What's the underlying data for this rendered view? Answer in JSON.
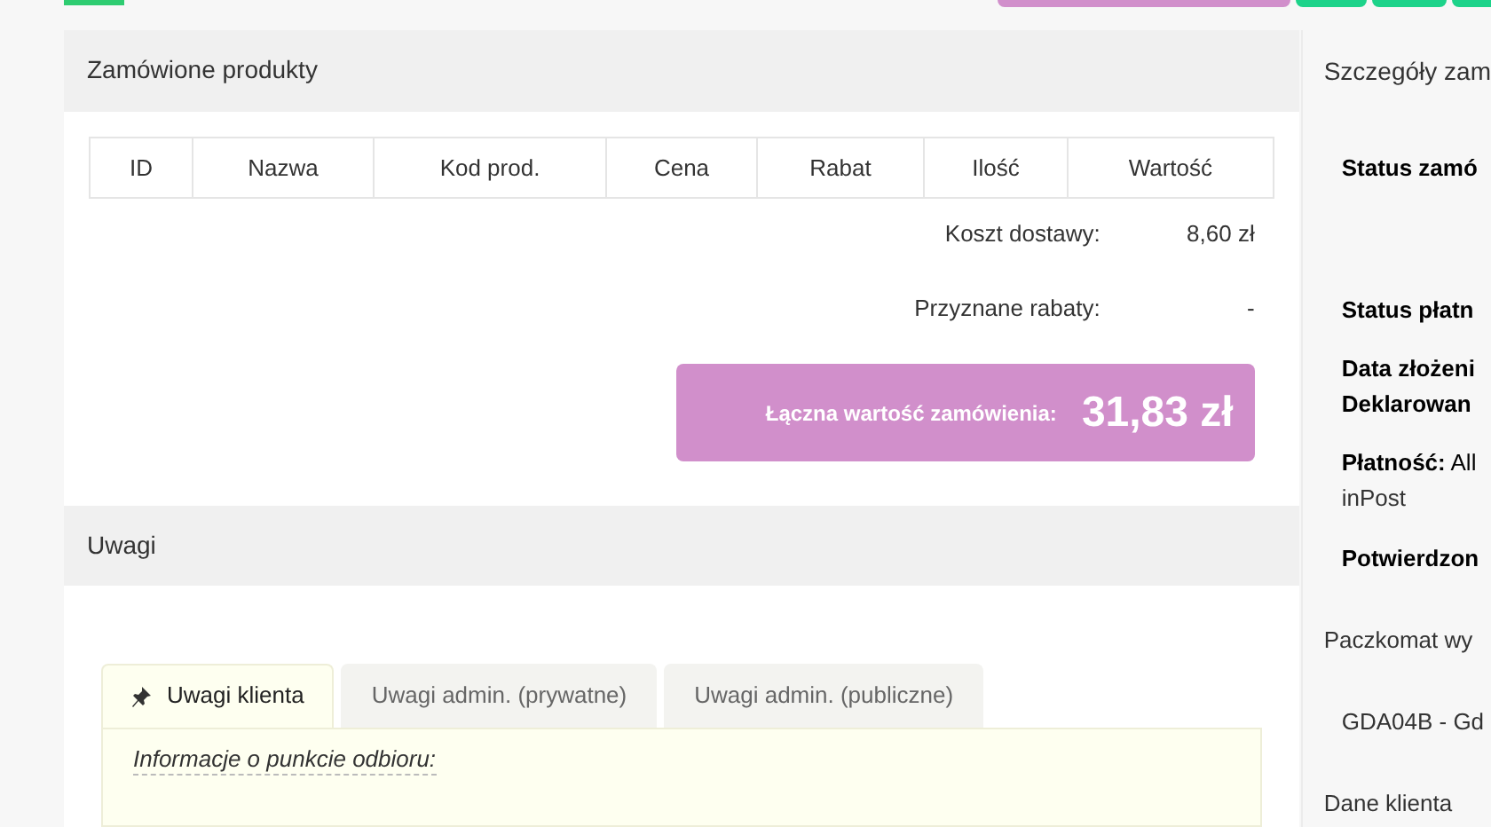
{
  "products": {
    "title": "Zamówione produkty",
    "columns": [
      "ID",
      "Nazwa",
      "Kod prod.",
      "Cena",
      "Rabat",
      "Ilość",
      "Wartość"
    ],
    "summary": [
      {
        "label": "Koszt dostawy:",
        "value": "8,60 zł"
      },
      {
        "label": "Przyznane rabaty:",
        "value": "-"
      }
    ],
    "total": {
      "label": "Łączna wartość zamówienia:",
      "value": "31,83 zł"
    }
  },
  "notes": {
    "title": "Uwagi",
    "tabs": [
      {
        "label": "Uwagi klienta",
        "selected": true
      },
      {
        "label": "Uwagi admin. (prywatne)",
        "selected": false
      },
      {
        "label": "Uwagi admin. (publiczne)",
        "selected": false
      }
    ],
    "content_heading": "Informacje o punkcie odbioru:"
  },
  "details": {
    "title": "Szczegóły zam",
    "lines": [
      {
        "kind": "bold",
        "text": "Status zamó"
      },
      {
        "kind": "bold",
        "text": "Status płatn"
      },
      {
        "kind": "bold",
        "text": "Data złożeni"
      },
      {
        "kind": "bold",
        "text": "Deklarowan"
      },
      {
        "kind": "labeled",
        "label": "Płatność:",
        "text": "All"
      },
      {
        "kind": "plain",
        "text": "inPost"
      },
      {
        "kind": "bold",
        "text": "Potwierdzon"
      },
      {
        "kind": "section",
        "text": "Paczkomat wy"
      },
      {
        "kind": "plain",
        "text": "GDA04B - Gd"
      },
      {
        "kind": "section",
        "text": "Dane klienta"
      }
    ]
  }
}
